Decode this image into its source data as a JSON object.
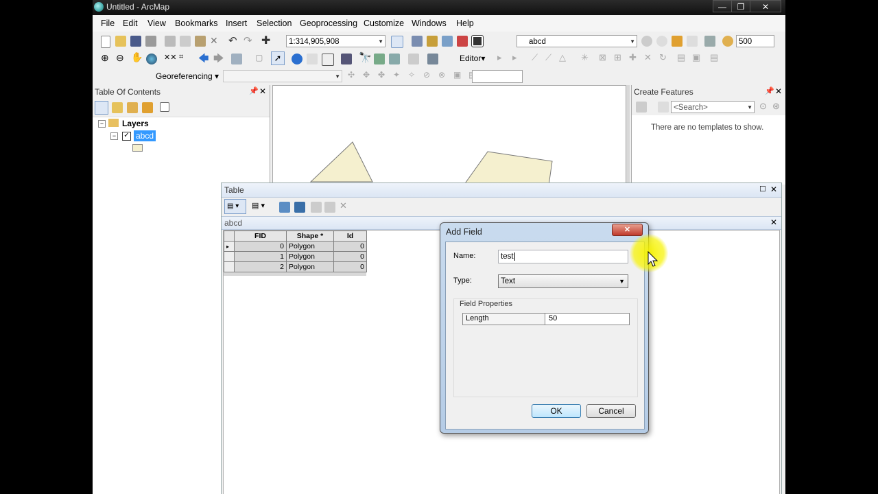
{
  "window": {
    "title": "Untitled - ArcMap",
    "controls": [
      "—",
      "❐",
      "✕"
    ]
  },
  "menu": [
    "File",
    "Edit",
    "View",
    "Bookmarks",
    "Insert",
    "Selection",
    "Geoprocessing",
    "Customize",
    "Windows",
    "Help"
  ],
  "toolbar": {
    "scale": "1:314,905,908",
    "layer_select": "abcd",
    "scale_value": "500",
    "editor_label": "Editor▾",
    "georef_label": "Georeferencing ▾"
  },
  "toc": {
    "title": "Table Of Contents",
    "root_label": "Layers",
    "layer_label": "abcd"
  },
  "create_features": {
    "title": "Create Features",
    "search_placeholder": "<Search>",
    "message": "There are no templates to show."
  },
  "table_window": {
    "title": "Table",
    "tab_name": "abcd",
    "columns": [
      "FID",
      "Shape *",
      "Id"
    ],
    "rows": [
      [
        "0",
        "Polygon",
        "0"
      ],
      [
        "1",
        "Polygon",
        "0"
      ],
      [
        "2",
        "Polygon",
        "0"
      ]
    ]
  },
  "dialog": {
    "title": "Add Field",
    "name_label": "Name:",
    "name_value": "test",
    "type_label": "Type:",
    "type_value": "Text",
    "group_label": "Field Properties",
    "prop_name": "Length",
    "prop_value": "50",
    "ok_label": "OK",
    "cancel_label": "Cancel",
    "close_glyph": "✕"
  },
  "colors": {
    "highlight": "#3399ff",
    "polygon_fill": "#f5f0cf",
    "cursor_highlight": "#f7f300"
  }
}
